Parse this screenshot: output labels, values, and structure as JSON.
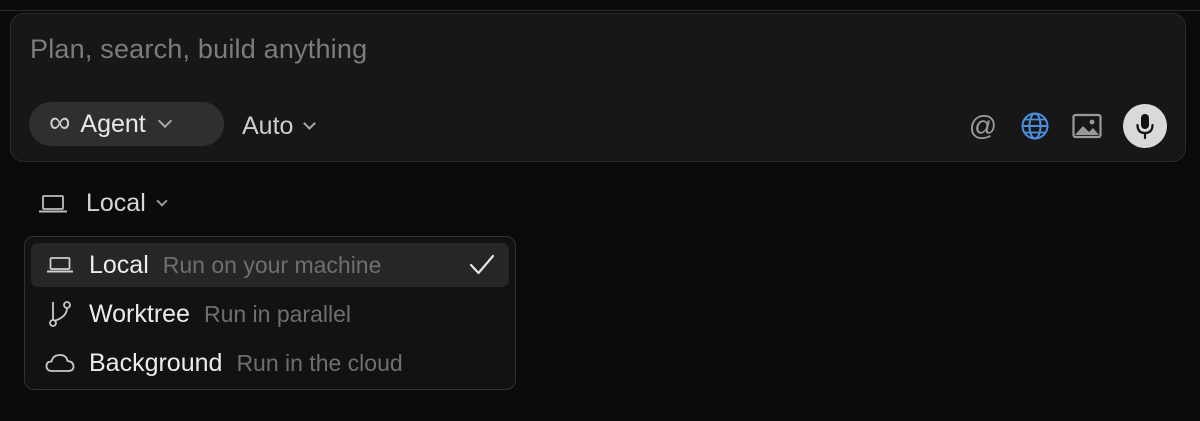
{
  "composer": {
    "placeholder": "Plan, search, build anything",
    "mode_label": "Agent",
    "model_label": "Auto",
    "icons": [
      "at-icon",
      "globe-icon",
      "image-icon",
      "microphone-icon"
    ],
    "globe_color": "#4a8fe0"
  },
  "environment": {
    "selected_label": "Local",
    "menu": [
      {
        "label": "Local",
        "description": "Run on your machine",
        "icon": "laptop-icon",
        "selected": true
      },
      {
        "label": "Worktree",
        "description": "Run in parallel",
        "icon": "git-branch-icon",
        "selected": false
      },
      {
        "label": "Background",
        "description": "Run in the cloud",
        "icon": "cloud-icon",
        "selected": false
      }
    ]
  },
  "colors": {
    "background": "#0b0b0b",
    "composer_bg": "#171717",
    "pill_bg": "#2f2f2f",
    "menu_bg": "#121212",
    "selected_row_bg": "#262626"
  }
}
